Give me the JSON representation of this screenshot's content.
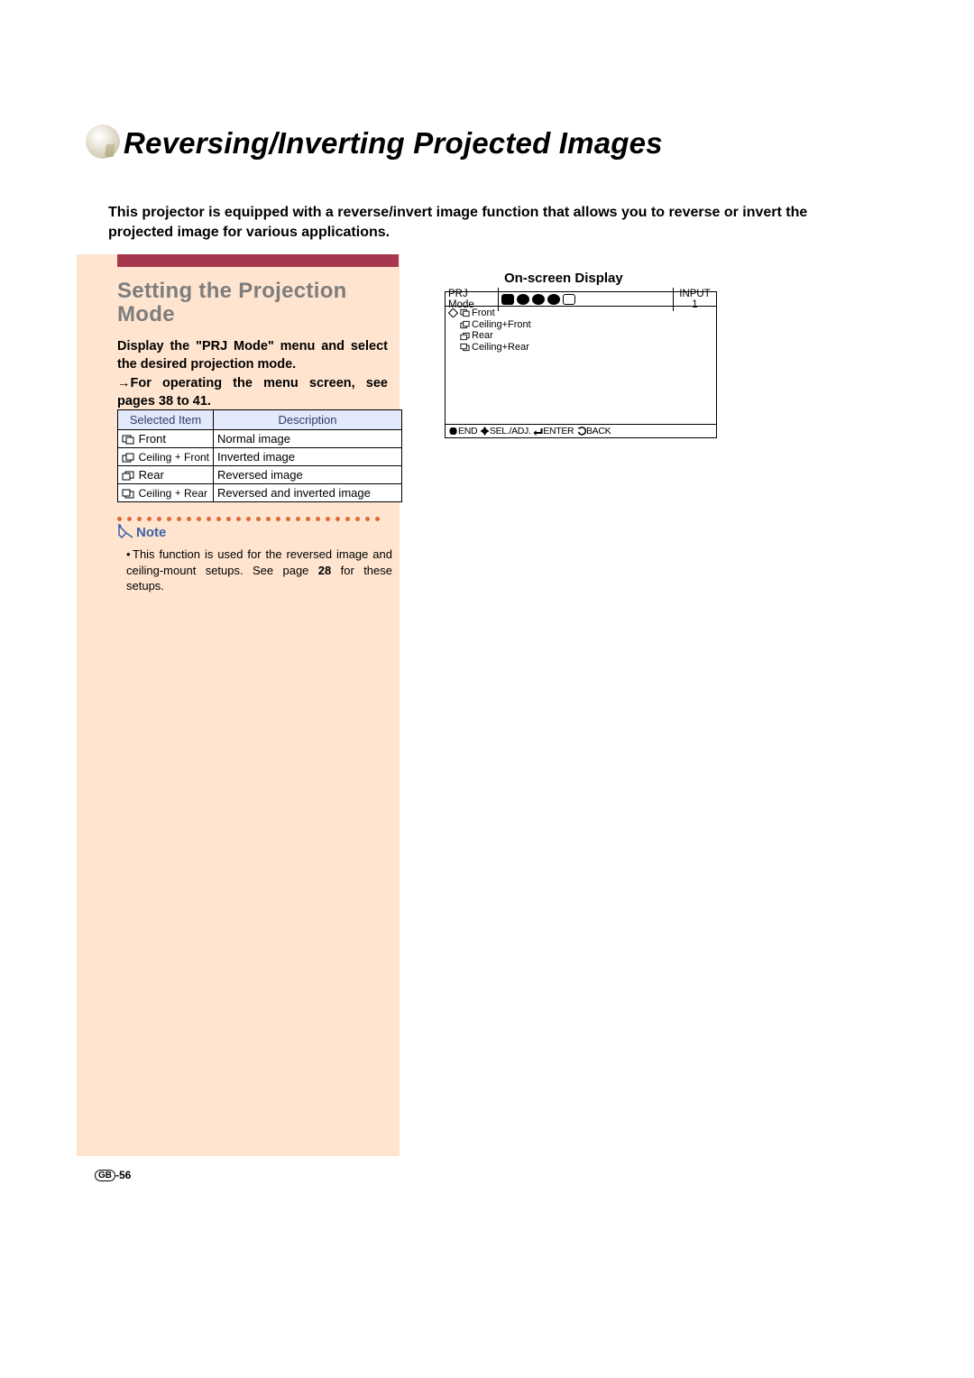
{
  "page_title": "Reversing/Inverting Projected Images",
  "intro": "This projector is equipped with a reverse/invert image function that allows you to reverse or invert the projected image for various applications.",
  "section": {
    "heading": "Setting the Projection Mode",
    "body_line1": "Display the \"PRJ Mode\" menu and select the desired projection mode.",
    "body_line2": "For operating the menu screen, see pages 38 to 41.",
    "table": {
      "head_col1": "Selected Item",
      "head_col2": "Description",
      "rows": [
        {
          "item": "Front",
          "desc": "Normal image"
        },
        {
          "item_a": "Ceiling",
          "item_b": "Front",
          "desc": "Inverted image"
        },
        {
          "item": "Rear",
          "desc": "Reversed image"
        },
        {
          "item_a": "Ceiling",
          "item_b": "Rear",
          "desc": "Reversed and inverted image"
        }
      ]
    },
    "note_label": "Note",
    "note_text": "This function is used for the reversed image and ceiling-mount setups. See page 28 for these setups.",
    "note_page_ref": "28"
  },
  "osd": {
    "label": "On-screen Display",
    "top_left": "PRJ Mode",
    "top_right": "INPUT 1",
    "menu": [
      "Front",
      "Ceiling+Front",
      "Rear",
      "Ceiling+Rear"
    ],
    "bottom": "END    SEL./ADJ.   ENTER   BACK"
  },
  "footer": {
    "region": "GB",
    "page": "-56"
  }
}
